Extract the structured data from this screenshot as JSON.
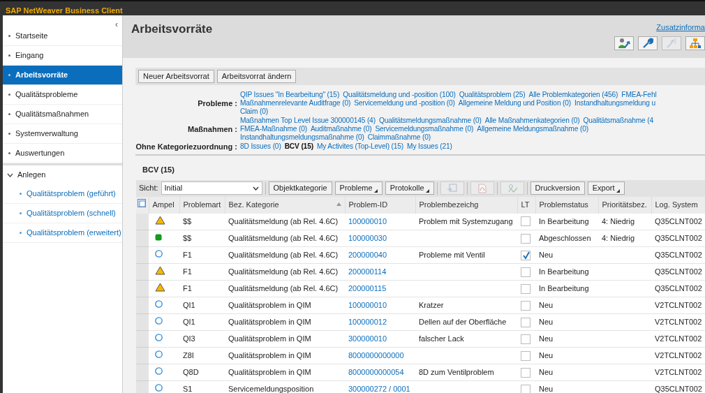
{
  "app_title": "SAP NetWeaver Business Client",
  "sidebar": {
    "collapse_glyph": "‹",
    "items": [
      {
        "label": "Startseite",
        "selected": false
      },
      {
        "label": "Eingang",
        "selected": false
      },
      {
        "label": "Arbeitsvorräte",
        "selected": true
      },
      {
        "label": "Qualitätsprobleme",
        "selected": false
      },
      {
        "label": "Qualitätsmaßnahmen",
        "selected": false
      },
      {
        "label": "Systemverwaltung",
        "selected": false
      },
      {
        "label": "Auswertungen",
        "selected": false
      }
    ],
    "group": {
      "label": "Anlegen",
      "expanded": true,
      "children": [
        {
          "label": "Qualitätsproblem (geführt)"
        },
        {
          "label": "Qualitätsproblem (schnell)"
        },
        {
          "label": "Qualitätsproblem (erweitert)"
        }
      ]
    }
  },
  "page_title": "Arbeitsvorräte",
  "header_link": "Zusatzinforma",
  "header_tools": [
    {
      "kind": "user"
    },
    {
      "kind": "wrench"
    },
    {
      "kind": "wrench-list",
      "disabled": true
    },
    {
      "kind": "hierarchy"
    }
  ],
  "buttons": [
    "Neuer Arbeitsvorrat",
    "Arbeitsvorrat ändern"
  ],
  "categories": [
    {
      "label": "Probleme :",
      "lines": [
        [
          {
            "text": "QIP Issues \"In Bearbeitung\" (15)",
            "selected": false
          },
          {
            "text": "Qualitätsmeldung und -position (100)",
            "selected": false
          },
          {
            "text": "Qualitätsproblem (25)",
            "selected": false
          },
          {
            "text": "Alle Problemkategorien (456)",
            "selected": false
          },
          {
            "text": "FMEA-Fehl",
            "selected": false
          }
        ],
        [
          {
            "text": "Maßnahmenrelevante Auditfrage (0)",
            "selected": false
          },
          {
            "text": "Servicemeldung und -position (0)",
            "selected": false
          },
          {
            "text": "Allgemeine Meldung und Position (0)",
            "selected": false
          },
          {
            "text": "Instandhaltungsmeldung u",
            "selected": false
          }
        ],
        [
          {
            "text": "Claim (0)",
            "selected": false
          }
        ]
      ]
    },
    {
      "label": "Maßnahmen :",
      "lines": [
        [
          {
            "text": "Maßnahmen Top Level Issue 300000145 (4)",
            "selected": false
          },
          {
            "text": "Qualitätsmeldungsmaßnahme (0)",
            "selected": false
          },
          {
            "text": "Alle Maßnahmenkategorien (0)",
            "selected": false
          },
          {
            "text": "Qualitätsmaßnahme (4",
            "selected": false
          }
        ],
        [
          {
            "text": "FMEA-Maßnahme (0)",
            "selected": false
          },
          {
            "text": "Auditmaßnahme (0)",
            "selected": false
          },
          {
            "text": "Servicemeldungsmaßnahme (0)",
            "selected": false
          },
          {
            "text": "Allgemeine Meldungsmaßnahme (0)",
            "selected": false
          }
        ],
        [
          {
            "text": "Instandhaltungsmeldungsmaßnahme (0)",
            "selected": false
          },
          {
            "text": "Claimmaßnahme (0)",
            "selected": false
          }
        ]
      ]
    },
    {
      "label": "Ohne Kategoriezuordnung :",
      "lines": [
        [
          {
            "text": "8D Issues (0)",
            "selected": false
          },
          {
            "text": "BCV (15)",
            "selected": true
          },
          {
            "text": "My Activites (Top-Level) (15)",
            "selected": false
          },
          {
            "text": "My Issues (21)",
            "selected": false
          }
        ]
      ]
    }
  ],
  "list_title": "BCV (15)",
  "toolbar": {
    "view_label": "Sicht:",
    "view_value": "Initial",
    "items": [
      {
        "kind": "button",
        "text": "Objektkategorie"
      },
      {
        "kind": "menu",
        "text": "Probleme"
      },
      {
        "kind": "menu",
        "text": "Protokolle"
      },
      {
        "kind": "export",
        "disabled": true
      },
      {
        "kind": "pdf",
        "disabled": true
      },
      {
        "kind": "check",
        "disabled": true
      },
      {
        "kind": "button",
        "text": "Druckversion"
      },
      {
        "kind": "menu",
        "text": "Export"
      }
    ]
  },
  "table": {
    "columns": [
      "Ampel",
      "Problemart",
      "Bez. Kategorie",
      "Problem-ID",
      "Problembezeichg",
      "LT",
      "Problemstatus",
      "Prioritätsbez.",
      "Log. System"
    ],
    "rows": [
      {
        "kind": "warning",
        "art": "$$",
        "kategorie": "Qualitätsmeldung (ab Rel. 4.6C)",
        "id": "100000010",
        "bez": "Problem mit Systemzugang",
        "lt": false,
        "status": "In Bearbeitung",
        "prio": "4: Niedrig",
        "system": "Q35CLNT002"
      },
      {
        "kind": "done",
        "art": "$$",
        "kategorie": "Qualitätsmeldung (ab Rel. 4.6C)",
        "id": "100000030",
        "bez": "",
        "lt": false,
        "status": "Abgeschlossen",
        "prio": "4: Niedrig",
        "system": "Q35CLNT002"
      },
      {
        "kind": "open",
        "art": "F1",
        "kategorie": "Qualitätsmeldung (ab Rel. 4.6C)",
        "id": "200000040",
        "bez": "Probleme mit Ventil",
        "lt": true,
        "status": "Neu",
        "prio": "",
        "system": "Q35CLNT002"
      },
      {
        "kind": "warning",
        "art": "F1",
        "kategorie": "Qualitätsmeldung (ab Rel. 4.6C)",
        "id": "200000114",
        "bez": "",
        "lt": false,
        "status": "In Bearbeitung",
        "prio": "",
        "system": "Q35CLNT002"
      },
      {
        "kind": "warning",
        "art": "F1",
        "kategorie": "Qualitätsmeldung (ab Rel. 4.6C)",
        "id": "200000115",
        "bez": "",
        "lt": false,
        "status": "In Bearbeitung",
        "prio": "",
        "system": "Q35CLNT002"
      },
      {
        "kind": "open",
        "art": "QI1",
        "kategorie": "Qualitätsproblem in QIM",
        "id": "100000010",
        "bez": "Kratzer",
        "lt": false,
        "status": "Neu",
        "prio": "",
        "system": "V2TCLNT002"
      },
      {
        "kind": "open",
        "art": "QI1",
        "kategorie": "Qualitätsproblem in QIM",
        "id": "100000012",
        "bez": "Dellen auf der Oberfläche",
        "lt": false,
        "status": "Neu",
        "prio": "",
        "system": "V2TCLNT002"
      },
      {
        "kind": "open",
        "art": "QI3",
        "kategorie": "Qualitätsproblem in QIM",
        "id": "300000010",
        "bez": "falscher Lack",
        "lt": false,
        "status": "Neu",
        "prio": "",
        "system": "V2TCLNT002"
      },
      {
        "kind": "open",
        "art": "Z8I",
        "kategorie": "Qualitätsproblem in QIM",
        "id": "8000000000000",
        "bez": "",
        "lt": false,
        "status": "Neu",
        "prio": "",
        "system": "V2TCLNT002"
      },
      {
        "kind": "open",
        "art": "Q8D",
        "kategorie": "Qualitätsproblem in QIM",
        "id": "8000000000054",
        "bez": "8D zum Ventilproblem",
        "lt": false,
        "status": "Neu",
        "prio": "",
        "system": "V2TCLNT002"
      },
      {
        "kind": "open",
        "art": "S1",
        "kategorie": "Servicemeldungsposition",
        "id": "300000272 / 0001",
        "bez": "",
        "lt": false,
        "status": "Neu",
        "prio": "",
        "system": "Q35CLNT002"
      }
    ]
  }
}
